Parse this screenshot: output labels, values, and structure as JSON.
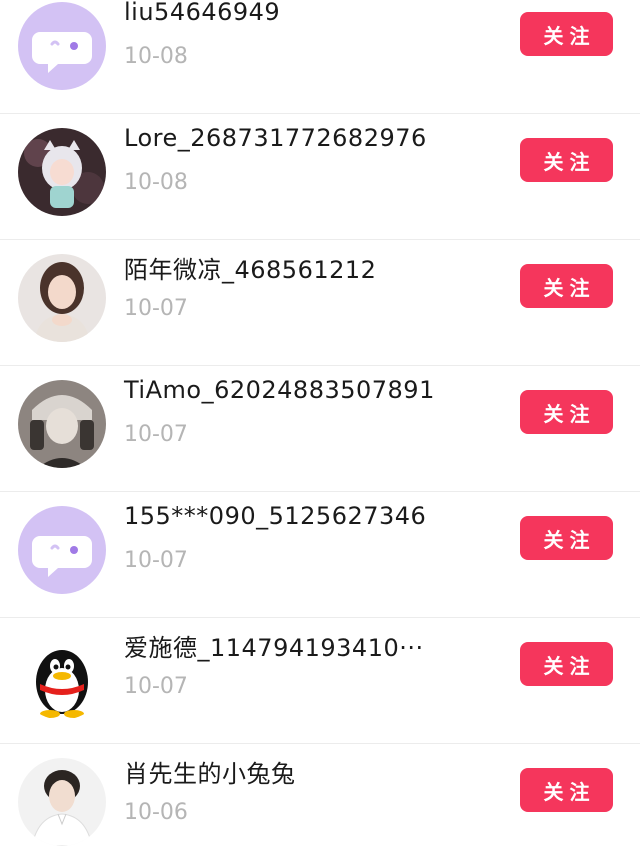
{
  "follow_label": "关注",
  "accent_color": "#f5365c",
  "rows": [
    {
      "name": "liu54646949",
      "date": "10-08",
      "avatar": "chat-bubble-avatar-icon"
    },
    {
      "name": "Lore_268731772682976",
      "date": "10-08",
      "avatar": "anime-girl-avatar"
    },
    {
      "name": "陌年微凉_468561212",
      "date": "10-07",
      "avatar": "woman-portrait-avatar"
    },
    {
      "name": "TiAmo_62024883507891",
      "date": "10-07",
      "avatar": "anime-boy-avatar"
    },
    {
      "name": "155***090_5125627346",
      "date": "10-07",
      "avatar": "chat-bubble-avatar-icon"
    },
    {
      "name": "爱施德_114794193410···",
      "date": "10-07",
      "avatar": "penguin-avatar-icon"
    },
    {
      "name": "肖先生的小兔兔",
      "date": "10-06",
      "avatar": "man-portrait-avatar"
    }
  ]
}
